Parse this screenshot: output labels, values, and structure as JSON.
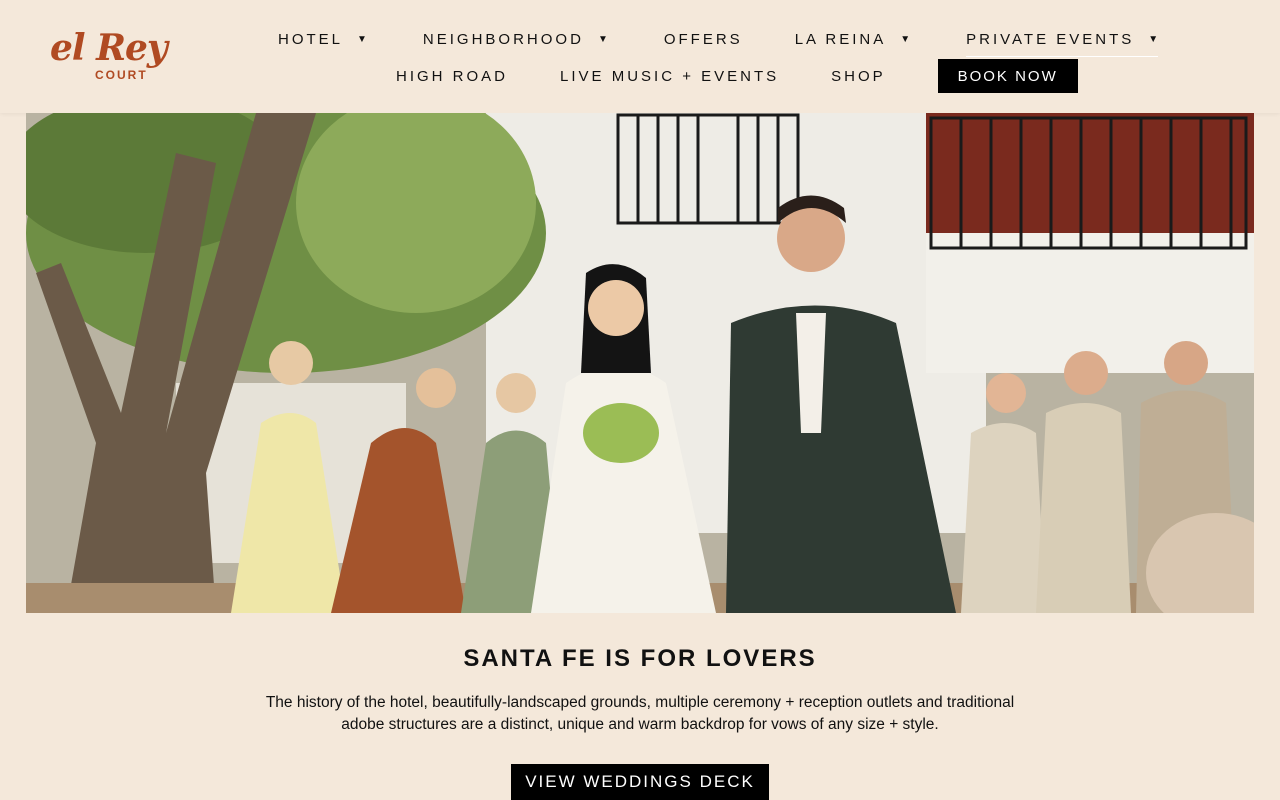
{
  "brand": {
    "logo_script": "el Rey",
    "logo_sub": "COURT",
    "color": "#b04a22"
  },
  "nav": {
    "row1": [
      {
        "label": "HOTEL",
        "has_dropdown": true
      },
      {
        "label": "NEIGHBORHOOD",
        "has_dropdown": true
      },
      {
        "label": "OFFERS",
        "has_dropdown": false
      },
      {
        "label": "LA REINA",
        "has_dropdown": true
      },
      {
        "label": "PRIVATE EVENTS",
        "has_dropdown": true
      }
    ],
    "row2": [
      {
        "label": "HIGH ROAD"
      },
      {
        "label": "LIVE MUSIC + EVENTS"
      },
      {
        "label": "SHOP"
      }
    ],
    "book_label": "BOOK NOW",
    "caret": "▼"
  },
  "hero": {
    "icon": "wedding-photo"
  },
  "section": {
    "headline": "SANTA FE IS FOR LOVERS",
    "body": "The history of the hotel, beautifully-landscaped grounds, multiple ceremony + reception outlets and traditional adobe structures are a distinct, unique and warm backdrop for vows of any size + style.",
    "cta_label": "VIEW WEDDINGS DECK"
  },
  "colors": {
    "background": "#f4e8da",
    "button": "#000000",
    "button_text": "#ffffff"
  }
}
